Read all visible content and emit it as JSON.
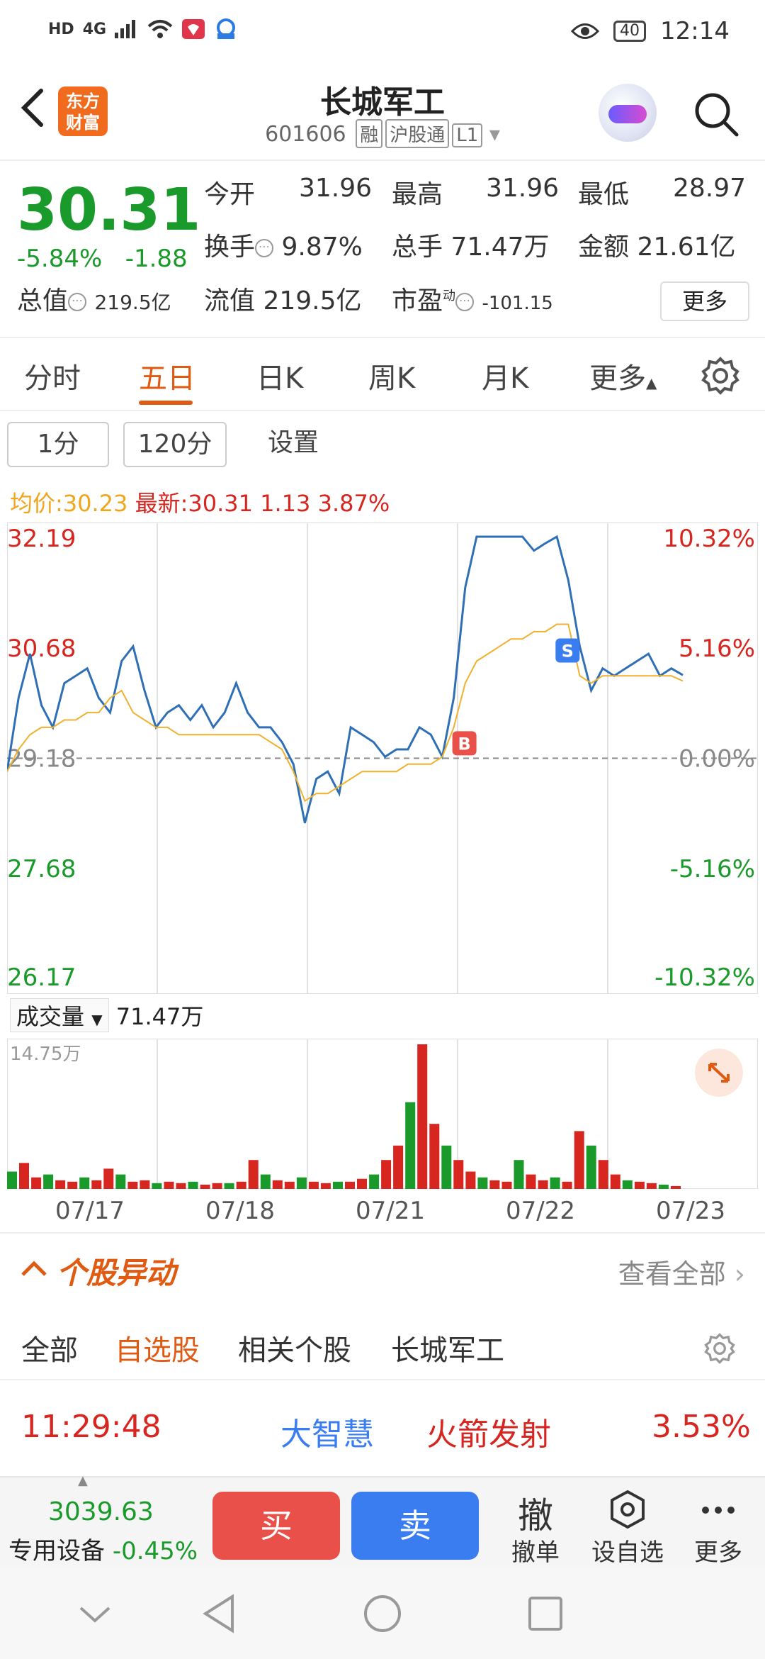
{
  "status_bar": {
    "left_icons": [
      "HD",
      "4G",
      "signal",
      "wifi",
      "app-icon",
      "app-icon-2"
    ],
    "battery": "40",
    "time": "12:14"
  },
  "header": {
    "logo_text": "东方财富",
    "title": "长城军工",
    "code": "601606",
    "tags": [
      "融",
      "沪股通",
      "L1"
    ]
  },
  "quote": {
    "price": "30.31",
    "change_pct": "-5.84%",
    "change_abs": "-1.88",
    "open_label": "今开",
    "open": "31.96",
    "high_label": "最高",
    "high": "31.96",
    "low_label": "最低",
    "low": "28.97",
    "turnover_label": "换手",
    "turnover": "9.87%",
    "volume_label": "总手",
    "volume": "71.47万",
    "amount_label": "金额",
    "amount": "21.61亿",
    "mktcap_label": "总值",
    "mktcap": "219.5亿",
    "float_label": "流值",
    "float": "219.5亿",
    "pe_label": "市盈",
    "pe_sup": "动",
    "pe": "-101.15",
    "more": "更多",
    "colors": {
      "up": "#d7261f",
      "down": "#1a9a2a"
    }
  },
  "tabs": [
    "分时",
    "五日",
    "日K",
    "周K",
    "月K",
    "更多"
  ],
  "active_tab": "五日",
  "controls": {
    "period1": "1分",
    "period2": "120分",
    "settings": "设置"
  },
  "avg_line": {
    "avg_label": "均价:",
    "avg": "30.23",
    "latest_label": "最新:",
    "latest": "30.31",
    "chg": "1.13",
    "pct": "3.87%"
  },
  "chart_data": {
    "type": "line",
    "title": "",
    "y_left_ticks": [
      "32.19",
      "30.68",
      "29.18",
      "27.68",
      "26.17"
    ],
    "y_right_ticks": [
      "10.32%",
      "5.16%",
      "0.00%",
      "-5.16%",
      "-10.32%"
    ],
    "ylim": [
      26.17,
      32.19
    ],
    "baseline": 29.18,
    "x_days": [
      "07/17",
      "07/18",
      "07/21",
      "07/22",
      "07/23"
    ],
    "series": [
      {
        "values": [
          29.0,
          30.0,
          30.6,
          29.9,
          29.6,
          30.2,
          30.3,
          30.4,
          30.0,
          29.8,
          30.5,
          30.7,
          30.1,
          29.6,
          29.8,
          29.9,
          29.7,
          29.9,
          29.6,
          29.8,
          30.2,
          29.8,
          29.6,
          29.6,
          29.4,
          29.1,
          28.3,
          28.9,
          29.0,
          28.7,
          29.6,
          29.5,
          29.4,
          29.2,
          29.3,
          29.3,
          29.6,
          29.5,
          29.2,
          30.0,
          31.5,
          32.19,
          32.19,
          32.19,
          32.19,
          32.19,
          32.0,
          32.1,
          32.19,
          31.6,
          30.7,
          30.1,
          30.4,
          30.3,
          30.4,
          30.5,
          30.6,
          30.3,
          30.4,
          30.31
        ]
      },
      {
        "values": [
          29.0,
          29.3,
          29.5,
          29.6,
          29.6,
          29.7,
          29.7,
          29.8,
          29.8,
          30.0,
          30.1,
          29.8,
          29.7,
          29.6,
          29.6,
          29.5,
          29.5,
          29.5,
          29.5,
          29.5,
          29.5,
          29.5,
          29.5,
          29.4,
          29.3,
          29.0,
          28.6,
          28.7,
          28.7,
          28.8,
          28.9,
          29.0,
          29.0,
          29.0,
          29.0,
          29.1,
          29.1,
          29.1,
          29.2,
          29.6,
          30.2,
          30.5,
          30.6,
          30.7,
          30.8,
          30.8,
          30.9,
          30.9,
          31.0,
          31.0,
          30.3,
          30.2,
          30.3,
          30.3,
          30.3,
          30.3,
          30.3,
          30.3,
          30.3,
          30.23
        ]
      }
    ],
    "markers": [
      {
        "label": "B",
        "color": "#e9504a"
      },
      {
        "label": "S",
        "color": "#3a7df0"
      }
    ]
  },
  "volume": {
    "label": "成交量",
    "value": "71.47万",
    "max_label": "14.75万",
    "bars": [
      0.12,
      0.18,
      0.08,
      0.1,
      0.06,
      0.05,
      0.08,
      0.06,
      0.14,
      0.1,
      0.05,
      0.06,
      0.04,
      0.05,
      0.04,
      0.05,
      0.03,
      0.04,
      0.04,
      0.05,
      0.2,
      0.1,
      0.06,
      0.05,
      0.08,
      0.05,
      0.04,
      0.05,
      0.05,
      0.07,
      0.1,
      0.2,
      0.3,
      0.6,
      1.0,
      0.45,
      0.3,
      0.2,
      0.12,
      0.08,
      0.06,
      0.05,
      0.2,
      0.1,
      0.06,
      0.08,
      0.05,
      0.4,
      0.3,
      0.2,
      0.1,
      0.06,
      0.05,
      0.04,
      0.03,
      0.02
    ]
  },
  "movements": {
    "title": "个股异动",
    "view_all": "查看全部",
    "filters": [
      "全部",
      "自选股",
      "相关个股",
      "长城军工"
    ],
    "active_filter": "自选股",
    "row": {
      "time": "11:29:48",
      "source": "大智慧",
      "event": "火箭发射",
      "pct": "3.53%"
    }
  },
  "bottom_bar": {
    "index_value": "3039.63",
    "index_label": "专用设备",
    "index_chg": "-0.45%",
    "buy": "买",
    "sell": "卖",
    "cancel_icon": "撤",
    "cancel": "撤单",
    "watch": "设自选",
    "more": "更多"
  }
}
